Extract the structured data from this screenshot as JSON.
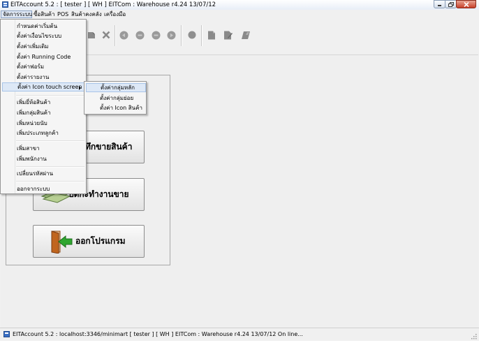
{
  "window": {
    "title": "EITAccount  5.2 : [ tester ] [ WH ]     EITCom : Warehouse     r4.24 13/07/12"
  },
  "menubar": [
    {
      "label": "จัดการระบบ",
      "open": true
    },
    {
      "label": "ซื้อสินค้า"
    },
    {
      "label": "POS"
    },
    {
      "label": "สินค้าคงคลัง"
    },
    {
      "label": "เครื่องมือ"
    }
  ],
  "dropdown": {
    "items": [
      "กำหนดค่าเริ่มต้น",
      "ตั้งค่าเงื่อนไขระบบ",
      "ตั้งค่าเพิ่มเติม",
      "ตั้งค่า Running Code",
      "ตั้งค่าฟอร์ม",
      "ตั้งค่ารายงาน",
      "ตั้งค่า Icon touch screen",
      "เพิ่มยี่ห้อสินค้า",
      "เพิ่มกลุ่มสินค้า",
      "เพิ่มหน่วยนับ",
      "เพิ่มประเภทลูกค้า",
      "เพิ่มสาขา",
      "เพิ่มพนักงาน",
      "เปลี่ยนรหัสผ่าน",
      "ออกจากระบบ"
    ]
  },
  "submenu": {
    "items": [
      "ตั้งค่ากลุ่มหลัก",
      "ตั้งค่ากลุ่มย่อย",
      "ตั้งค่า Icon สินค้า"
    ]
  },
  "main_buttons": {
    "sales_label": "ทึกขายสินค้า",
    "shift_label": "ปิดกะทำงานขาย",
    "exit_label": "ออกโปรแกรม"
  },
  "statusbar": {
    "text": "EITAccount   5.2 : localhost:3346/minimart  [ tester ] [ WH ]     EITCom : Warehouse     r4.24 13/07/12  On line..."
  },
  "colors": {
    "menu_highlight": "#dde8f6",
    "exit_arrow": "#2fa62f",
    "door": "#c0651e"
  }
}
